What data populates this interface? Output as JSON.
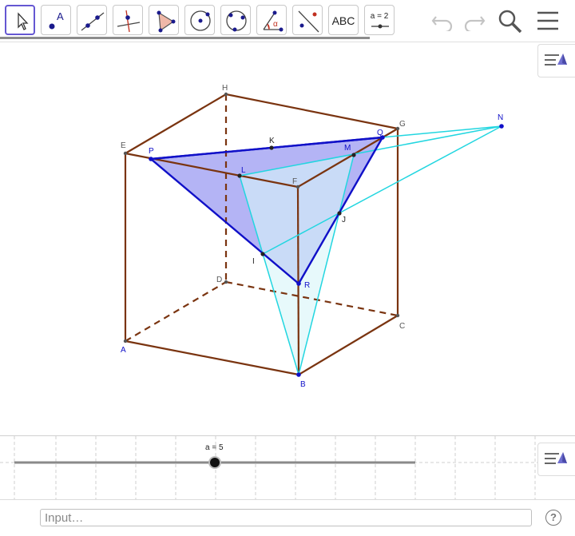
{
  "toolbar": {
    "tools": [
      {
        "name": "move-tool",
        "selected": true
      },
      {
        "name": "point-tool"
      },
      {
        "name": "line-tool"
      },
      {
        "name": "perpendicular-line-tool"
      },
      {
        "name": "polygon-tool"
      },
      {
        "name": "circle-center-point-tool"
      },
      {
        "name": "circle-three-points-tool"
      },
      {
        "name": "angle-tool"
      },
      {
        "name": "reflect-tool"
      },
      {
        "name": "text-tool",
        "label": "ABC"
      },
      {
        "name": "slider-tool",
        "label": "a = 2"
      }
    ],
    "point_icon_label": "A",
    "angle_icon_label": "α",
    "undo_icon": "undo-icon",
    "redo_icon": "redo-icon",
    "search_icon": "search-icon",
    "menu_icon": "menu-icon"
  },
  "graphics": {
    "vertices": [
      {
        "label": "H"
      },
      {
        "label": "G"
      },
      {
        "label": "N"
      },
      {
        "label": "K"
      },
      {
        "label": "Q"
      },
      {
        "label": "E"
      },
      {
        "label": "M"
      },
      {
        "label": "P"
      },
      {
        "label": "L"
      },
      {
        "label": "F"
      },
      {
        "label": "J"
      },
      {
        "label": "I"
      },
      {
        "label": "D"
      },
      {
        "label": "R"
      },
      {
        "label": "C"
      },
      {
        "label": "A"
      },
      {
        "label": "B"
      }
    ],
    "colors": {
      "cube_edges": "#7a3410",
      "section_polygon": "#1010c8",
      "section_fill": "#6666ee",
      "construction_lines": "#22d6e0",
      "construction_fill": "#c8f2f5",
      "point_labels": "#1010c8",
      "cube_labels": "#555555"
    }
  },
  "graphics2": {
    "slider": {
      "label": "a = 5",
      "value": 5
    }
  },
  "input_bar": {
    "placeholder": "Input…",
    "help_label": "?"
  }
}
